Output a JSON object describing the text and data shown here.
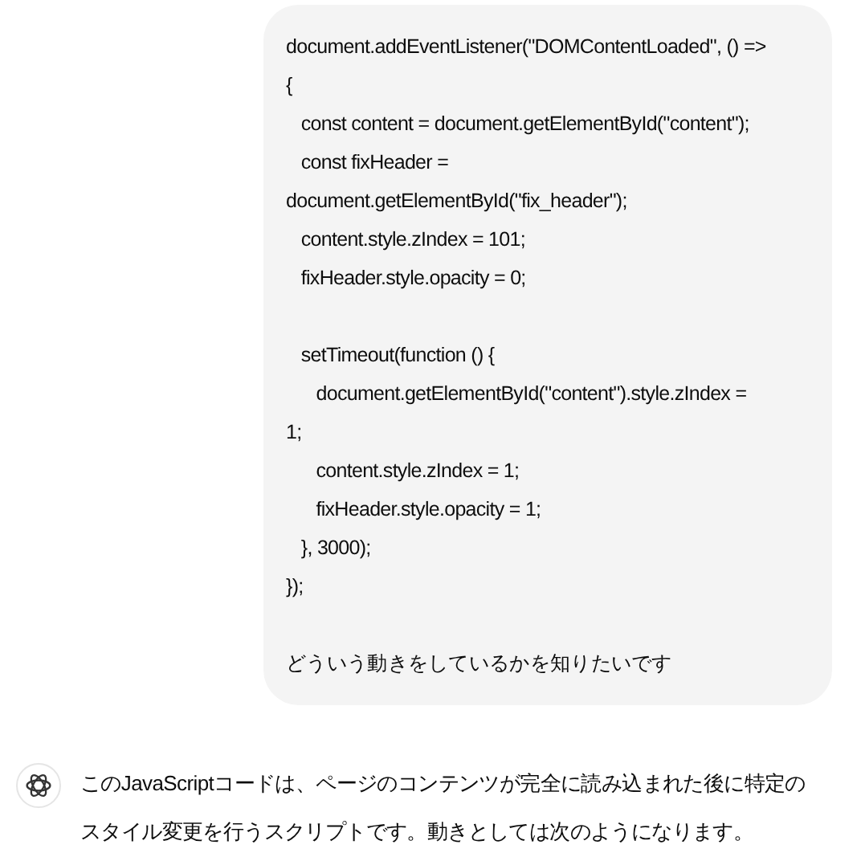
{
  "user_message": {
    "code_blocks": [
      [
        "document.addEventListener(\"DOMContentLoaded\", () =>",
        "{",
        "   const content = document.getElementById(\"content\");",
        "   const fixHeader =",
        "document.getElementById(\"fix_header\");",
        "   content.style.zIndex = 101;",
        "   fixHeader.style.opacity = 0;"
      ],
      [
        "   setTimeout(function () {",
        "      document.getElementById(\"content\").style.zIndex =",
        "1;",
        "      content.style.zIndex = 1;",
        "      fixHeader.style.opacity = 1;",
        "   }, 3000);",
        "});"
      ],
      [
        "どういう動きをしているかを知りたいです"
      ]
    ]
  },
  "assistant_message": {
    "text": "このJavaScriptコードは、ページのコンテンツが完全に読み込まれた後に特定のスタイル変更を行うスクリプトです。動きとしては次のようになります。"
  }
}
